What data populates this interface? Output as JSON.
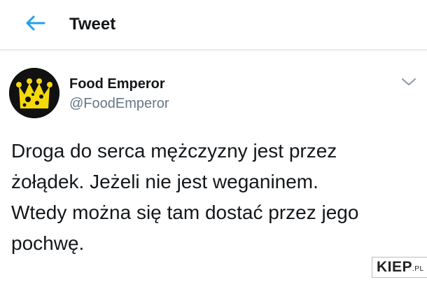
{
  "header": {
    "title": "Tweet",
    "back_icon": "arrow-left-icon",
    "accent_color": "#1da1f2"
  },
  "tweet": {
    "author_name": "Food Emperor",
    "author_handle": "@FoodEmperor",
    "avatar_icon": "crown-cheese-avatar",
    "menu_icon": "chevron-down-icon",
    "text": "Droga do serca mężczyzny jest przez\nżołądek. Jeżeli nie jest weganinem.\nWtedy można się tam dostać przez jego\npochwę."
  },
  "watermark": {
    "main": "KIEP",
    "sub": ".PL"
  },
  "colors": {
    "text": "#14171a",
    "secondary": "#657786",
    "divider": "#e6ecf0",
    "avatar_bg": "#111111",
    "avatar_crown": "#f5d90a"
  }
}
